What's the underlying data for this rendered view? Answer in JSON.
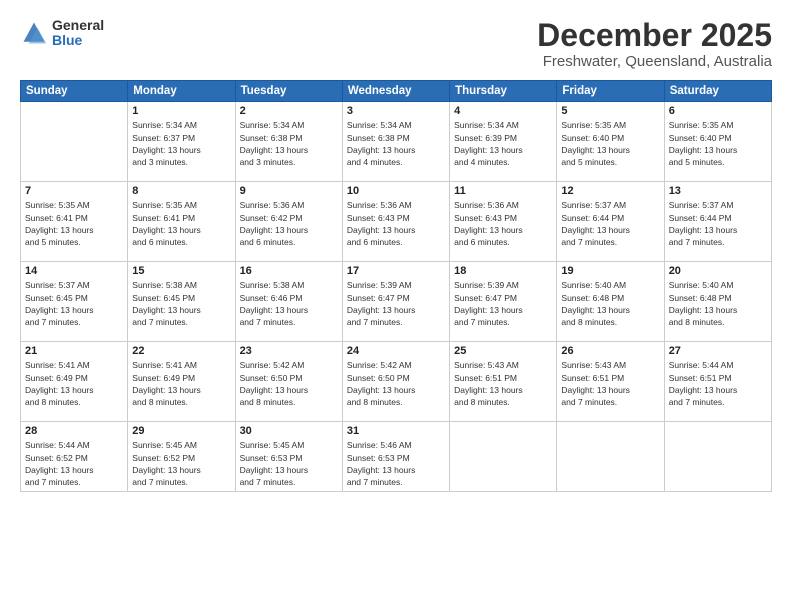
{
  "logo": {
    "general": "General",
    "blue": "Blue"
  },
  "header": {
    "title": "December 2025",
    "subtitle": "Freshwater, Queensland, Australia"
  },
  "days_of_week": [
    "Sunday",
    "Monday",
    "Tuesday",
    "Wednesday",
    "Thursday",
    "Friday",
    "Saturday"
  ],
  "weeks": [
    [
      {
        "day": "",
        "empty": true
      },
      {
        "day": "1",
        "sunrise": "Sunrise: 5:34 AM",
        "sunset": "Sunset: 6:37 PM",
        "daylight": "Daylight: 13 hours and 3 minutes."
      },
      {
        "day": "2",
        "sunrise": "Sunrise: 5:34 AM",
        "sunset": "Sunset: 6:38 PM",
        "daylight": "Daylight: 13 hours and 3 minutes."
      },
      {
        "day": "3",
        "sunrise": "Sunrise: 5:34 AM",
        "sunset": "Sunset: 6:38 PM",
        "daylight": "Daylight: 13 hours and 4 minutes."
      },
      {
        "day": "4",
        "sunrise": "Sunrise: 5:34 AM",
        "sunset": "Sunset: 6:39 PM",
        "daylight": "Daylight: 13 hours and 4 minutes."
      },
      {
        "day": "5",
        "sunrise": "Sunrise: 5:35 AM",
        "sunset": "Sunset: 6:40 PM",
        "daylight": "Daylight: 13 hours and 5 minutes."
      },
      {
        "day": "6",
        "sunrise": "Sunrise: 5:35 AM",
        "sunset": "Sunset: 6:40 PM",
        "daylight": "Daylight: 13 hours and 5 minutes."
      }
    ],
    [
      {
        "day": "7",
        "sunrise": "Sunrise: 5:35 AM",
        "sunset": "Sunset: 6:41 PM",
        "daylight": "Daylight: 13 hours and 5 minutes."
      },
      {
        "day": "8",
        "sunrise": "Sunrise: 5:35 AM",
        "sunset": "Sunset: 6:41 PM",
        "daylight": "Daylight: 13 hours and 6 minutes."
      },
      {
        "day": "9",
        "sunrise": "Sunrise: 5:36 AM",
        "sunset": "Sunset: 6:42 PM",
        "daylight": "Daylight: 13 hours and 6 minutes."
      },
      {
        "day": "10",
        "sunrise": "Sunrise: 5:36 AM",
        "sunset": "Sunset: 6:43 PM",
        "daylight": "Daylight: 13 hours and 6 minutes."
      },
      {
        "day": "11",
        "sunrise": "Sunrise: 5:36 AM",
        "sunset": "Sunset: 6:43 PM",
        "daylight": "Daylight: 13 hours and 6 minutes."
      },
      {
        "day": "12",
        "sunrise": "Sunrise: 5:37 AM",
        "sunset": "Sunset: 6:44 PM",
        "daylight": "Daylight: 13 hours and 7 minutes."
      },
      {
        "day": "13",
        "sunrise": "Sunrise: 5:37 AM",
        "sunset": "Sunset: 6:44 PM",
        "daylight": "Daylight: 13 hours and 7 minutes."
      }
    ],
    [
      {
        "day": "14",
        "sunrise": "Sunrise: 5:37 AM",
        "sunset": "Sunset: 6:45 PM",
        "daylight": "Daylight: 13 hours and 7 minutes."
      },
      {
        "day": "15",
        "sunrise": "Sunrise: 5:38 AM",
        "sunset": "Sunset: 6:45 PM",
        "daylight": "Daylight: 13 hours and 7 minutes."
      },
      {
        "day": "16",
        "sunrise": "Sunrise: 5:38 AM",
        "sunset": "Sunset: 6:46 PM",
        "daylight": "Daylight: 13 hours and 7 minutes."
      },
      {
        "day": "17",
        "sunrise": "Sunrise: 5:39 AM",
        "sunset": "Sunset: 6:47 PM",
        "daylight": "Daylight: 13 hours and 7 minutes."
      },
      {
        "day": "18",
        "sunrise": "Sunrise: 5:39 AM",
        "sunset": "Sunset: 6:47 PM",
        "daylight": "Daylight: 13 hours and 7 minutes."
      },
      {
        "day": "19",
        "sunrise": "Sunrise: 5:40 AM",
        "sunset": "Sunset: 6:48 PM",
        "daylight": "Daylight: 13 hours and 8 minutes."
      },
      {
        "day": "20",
        "sunrise": "Sunrise: 5:40 AM",
        "sunset": "Sunset: 6:48 PM",
        "daylight": "Daylight: 13 hours and 8 minutes."
      }
    ],
    [
      {
        "day": "21",
        "sunrise": "Sunrise: 5:41 AM",
        "sunset": "Sunset: 6:49 PM",
        "daylight": "Daylight: 13 hours and 8 minutes."
      },
      {
        "day": "22",
        "sunrise": "Sunrise: 5:41 AM",
        "sunset": "Sunset: 6:49 PM",
        "daylight": "Daylight: 13 hours and 8 minutes."
      },
      {
        "day": "23",
        "sunrise": "Sunrise: 5:42 AM",
        "sunset": "Sunset: 6:50 PM",
        "daylight": "Daylight: 13 hours and 8 minutes."
      },
      {
        "day": "24",
        "sunrise": "Sunrise: 5:42 AM",
        "sunset": "Sunset: 6:50 PM",
        "daylight": "Daylight: 13 hours and 8 minutes."
      },
      {
        "day": "25",
        "sunrise": "Sunrise: 5:43 AM",
        "sunset": "Sunset: 6:51 PM",
        "daylight": "Daylight: 13 hours and 8 minutes."
      },
      {
        "day": "26",
        "sunrise": "Sunrise: 5:43 AM",
        "sunset": "Sunset: 6:51 PM",
        "daylight": "Daylight: 13 hours and 7 minutes."
      },
      {
        "day": "27",
        "sunrise": "Sunrise: 5:44 AM",
        "sunset": "Sunset: 6:51 PM",
        "daylight": "Daylight: 13 hours and 7 minutes."
      }
    ],
    [
      {
        "day": "28",
        "sunrise": "Sunrise: 5:44 AM",
        "sunset": "Sunset: 6:52 PM",
        "daylight": "Daylight: 13 hours and 7 minutes."
      },
      {
        "day": "29",
        "sunrise": "Sunrise: 5:45 AM",
        "sunset": "Sunset: 6:52 PM",
        "daylight": "Daylight: 13 hours and 7 minutes."
      },
      {
        "day": "30",
        "sunrise": "Sunrise: 5:45 AM",
        "sunset": "Sunset: 6:53 PM",
        "daylight": "Daylight: 13 hours and 7 minutes."
      },
      {
        "day": "31",
        "sunrise": "Sunrise: 5:46 AM",
        "sunset": "Sunset: 6:53 PM",
        "daylight": "Daylight: 13 hours and 7 minutes."
      },
      {
        "day": "",
        "empty": true
      },
      {
        "day": "",
        "empty": true
      },
      {
        "day": "",
        "empty": true
      }
    ]
  ]
}
